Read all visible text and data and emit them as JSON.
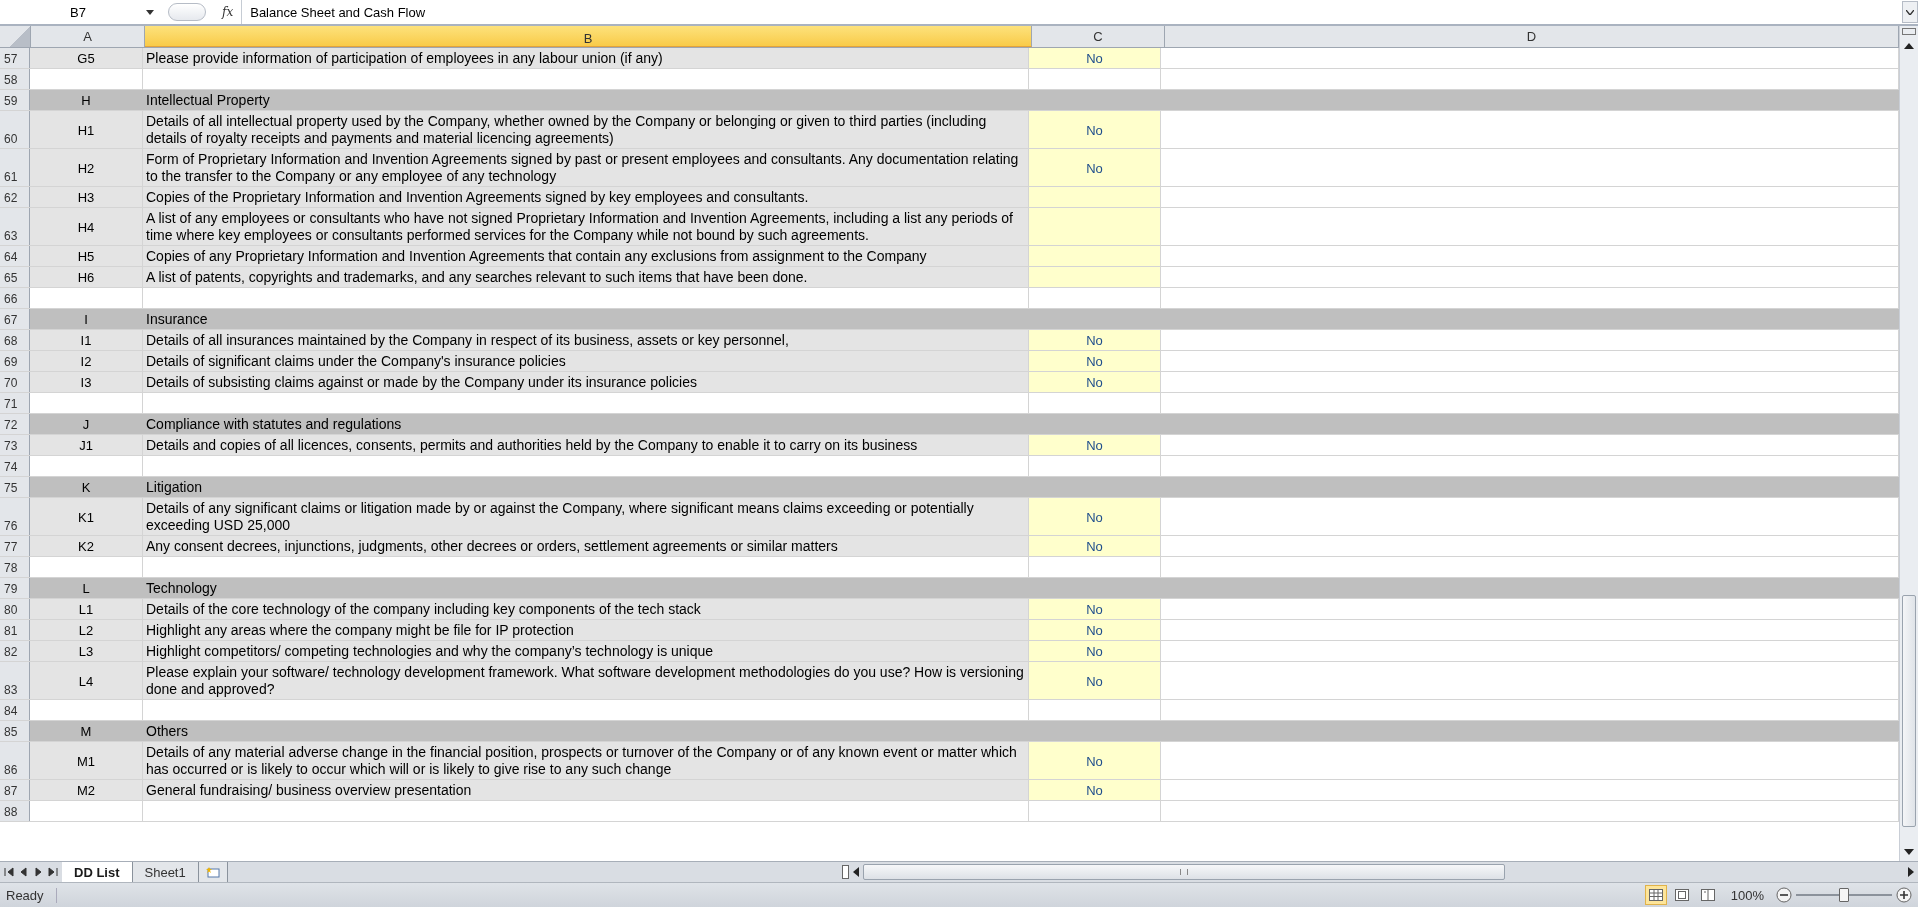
{
  "formula_bar": {
    "name_box": "B7",
    "function_button": "fx",
    "formula": "Balance Sheet and Cash Flow"
  },
  "columns": [
    {
      "label": "A",
      "selected": false
    },
    {
      "label": "B",
      "selected": true
    },
    {
      "label": "C",
      "selected": false
    },
    {
      "label": "D",
      "selected": false
    }
  ],
  "rows": [
    {
      "number": "57",
      "kind": "item",
      "a": "G5",
      "b": "Please provide information of participation of employees in any labour union (if any)",
      "c": "No"
    },
    {
      "number": "58",
      "kind": "blank"
    },
    {
      "number": "59",
      "kind": "section",
      "a": "H",
      "b": "Intellectual Property"
    },
    {
      "number": "60",
      "kind": "item",
      "a": "H1",
      "b": "Details of all intellectual property used by the Company, whether owned by the Company or belonging or given to third parties (including details of royalty receipts and payments and material licencing agreements)",
      "c": "No"
    },
    {
      "number": "61",
      "kind": "item",
      "a": "H2",
      "b": "Form of Proprietary Information and Invention  Agreements signed by past or present employees and consultants. Any documentation relating to the transfer to the Company or any employee of any technology",
      "c": "No"
    },
    {
      "number": "62",
      "kind": "item",
      "a": "H3",
      "b": "Copies of the Proprietary Information and Invention Agreements signed by key employees and consultants."
    },
    {
      "number": "63",
      "kind": "item",
      "a": "H4",
      "b": "A list of any employees or consultants who have not signed Proprietary Information and Invention Agreements, including a list any periods of time where key employees or consultants performed services for the Company while not bound by such agreements."
    },
    {
      "number": "64",
      "kind": "item",
      "a": "H5",
      "b": "Copies of any Proprietary Information and Invention Agreements that contain any exclusions from assignment to the Company"
    },
    {
      "number": "65",
      "kind": "item",
      "a": "H6",
      "b": "A list of patents, copyrights and trademarks, and any searches relevant to such items that have been done."
    },
    {
      "number": "66",
      "kind": "blank"
    },
    {
      "number": "67",
      "kind": "section",
      "a": "I",
      "b": "Insurance"
    },
    {
      "number": "68",
      "kind": "item",
      "a": "I1",
      "b": "Details of all insurances maintained by the Company in respect of its business, assets or key personnel,",
      "c": "No"
    },
    {
      "number": "69",
      "kind": "item",
      "a": "I2",
      "b": "Details of significant claims under the Company's insurance policies",
      "c": "No"
    },
    {
      "number": "70",
      "kind": "item",
      "a": "I3",
      "b": "Details of subsisting claims against or made by the Company under its insurance policies",
      "c": "No"
    },
    {
      "number": "71",
      "kind": "blank"
    },
    {
      "number": "72",
      "kind": "section",
      "a": "J",
      "b": "Compliance with statutes and regulations"
    },
    {
      "number": "73",
      "kind": "item",
      "a": "J1",
      "b": "Details and copies of all licences, consents, permits and authorities held by the Company to enable it to carry on its business",
      "c": "No"
    },
    {
      "number": "74",
      "kind": "blank"
    },
    {
      "number": "75",
      "kind": "section",
      "a": "K",
      "b": "Litigation"
    },
    {
      "number": "76",
      "kind": "item",
      "a": "K1",
      "b": "Details of any significant claims or litigation made by or against the Company, where significant means claims exceeding or potentially exceeding USD 25,000",
      "c": "No"
    },
    {
      "number": "77",
      "kind": "item",
      "a": "K2",
      "b": "Any consent decrees, injunctions, judgments, other decrees or orders, settlement agreements or similar matters",
      "c": "No"
    },
    {
      "number": "78",
      "kind": "blank"
    },
    {
      "number": "79",
      "kind": "section",
      "a": "L",
      "b": "Technology"
    },
    {
      "number": "80",
      "kind": "item",
      "a": "L1",
      "b": "Details of the core technology of the company including key components of the tech stack",
      "c": "No"
    },
    {
      "number": "81",
      "kind": "item",
      "a": "L2",
      "b": "Highlight any areas where the company might be file for IP protection",
      "c": "No"
    },
    {
      "number": "82",
      "kind": "item",
      "a": "L3",
      "b": "Highlight competitors/ competing technologies and why the company’s technology is unique",
      "c": "No"
    },
    {
      "number": "83",
      "kind": "item",
      "a": "L4",
      "b": "Please explain your software/ technology development framework. What software development methodologies do you use? How is versioning done and approved?",
      "c": "No"
    },
    {
      "number": "84",
      "kind": "blank"
    },
    {
      "number": "85",
      "kind": "section",
      "a": "M",
      "b": "Others"
    },
    {
      "number": "86",
      "kind": "item",
      "a": "M1",
      "b": "Details of any material adverse change in the financial position, prospects or turnover of the Company or of any known event or matter which has occurred or is likely to occur which will or is likely to give rise to any such change",
      "c": "No"
    },
    {
      "number": "87",
      "kind": "item",
      "a": "M2",
      "b": "General fundraising/ business overview presentation",
      "c": "No"
    },
    {
      "number": "88",
      "kind": "blank"
    }
  ],
  "sheet_tabs": [
    {
      "label": "DD List",
      "selected": true
    },
    {
      "label": "Sheet1",
      "selected": false
    }
  ],
  "status_bar": {
    "status": "Ready",
    "zoom": "100%",
    "zoom_slider": {
      "level": 0.5
    },
    "views": [
      {
        "kind": "normal",
        "selected": true
      },
      {
        "kind": "layout",
        "selected": false
      },
      {
        "kind": "pagebreak",
        "selected": false
      }
    ]
  }
}
